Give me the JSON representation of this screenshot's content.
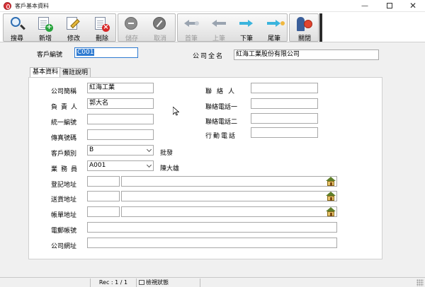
{
  "window": {
    "title": "客戶基本資料",
    "minimize_glyph": "—",
    "close_glyph": "✕"
  },
  "toolbar": {
    "buttons": [
      {
        "label": "搜尋",
        "icon": "search-icon",
        "enabled": true
      },
      {
        "label": "新增",
        "icon": "add-document-icon",
        "enabled": true
      },
      {
        "label": "修改",
        "icon": "edit-document-icon",
        "enabled": true
      },
      {
        "label": "刪除",
        "icon": "delete-document-icon",
        "enabled": true
      },
      {
        "label": "儲存",
        "icon": "save-icon",
        "enabled": false
      },
      {
        "label": "取消",
        "icon": "cancel-icon",
        "enabled": false
      },
      {
        "label": "首筆",
        "icon": "first-record-icon",
        "enabled": false
      },
      {
        "label": "上筆",
        "icon": "previous-record-icon",
        "enabled": false
      },
      {
        "label": "下筆",
        "icon": "next-record-icon",
        "enabled": true
      },
      {
        "label": "尾筆",
        "icon": "last-record-icon",
        "enabled": true
      },
      {
        "label": "關閉",
        "icon": "exit-icon",
        "enabled": true
      }
    ]
  },
  "header": {
    "customer_no_label": "客戶編號",
    "customer_no_value": "C001",
    "full_name_label": "公司全名",
    "full_name_value": "紅海工業股份有限公司"
  },
  "tabs": [
    {
      "label": "基本資料",
      "active": true
    },
    {
      "label": "備註說明",
      "active": false
    }
  ],
  "form": {
    "short_name_label": "公司簡稱",
    "short_name_value": "紅海工業",
    "owner_label": "負責人",
    "owner_value": "郭大名",
    "tax_id_label": "統一編號",
    "tax_id_value": "",
    "fax_label": "傳真號碼",
    "fax_value": "",
    "category_label": "客戶類別",
    "category_value": "B",
    "category_desc": "批發",
    "sales_label": "業務員",
    "sales_value": "A001",
    "sales_desc": "陳大雄",
    "reg_addr_label": "登記地址",
    "ship_addr_label": "送貨地址",
    "bill_addr_label": "帳單地址",
    "email_label": "電郵帳號",
    "website_label": "公司網址",
    "contact_label": "聯絡人",
    "phone1_label": "聯絡電話一",
    "phone2_label": "聯絡電話二",
    "mobile_label": "行動電話"
  },
  "status": {
    "record": "Rec : 1 / 1",
    "mode": "檢視狀態"
  },
  "colors": {
    "selection": "#2f7bd1",
    "accent_next": "#3ab4dd",
    "delete_red": "#d72727",
    "add_green": "#28a33d"
  }
}
